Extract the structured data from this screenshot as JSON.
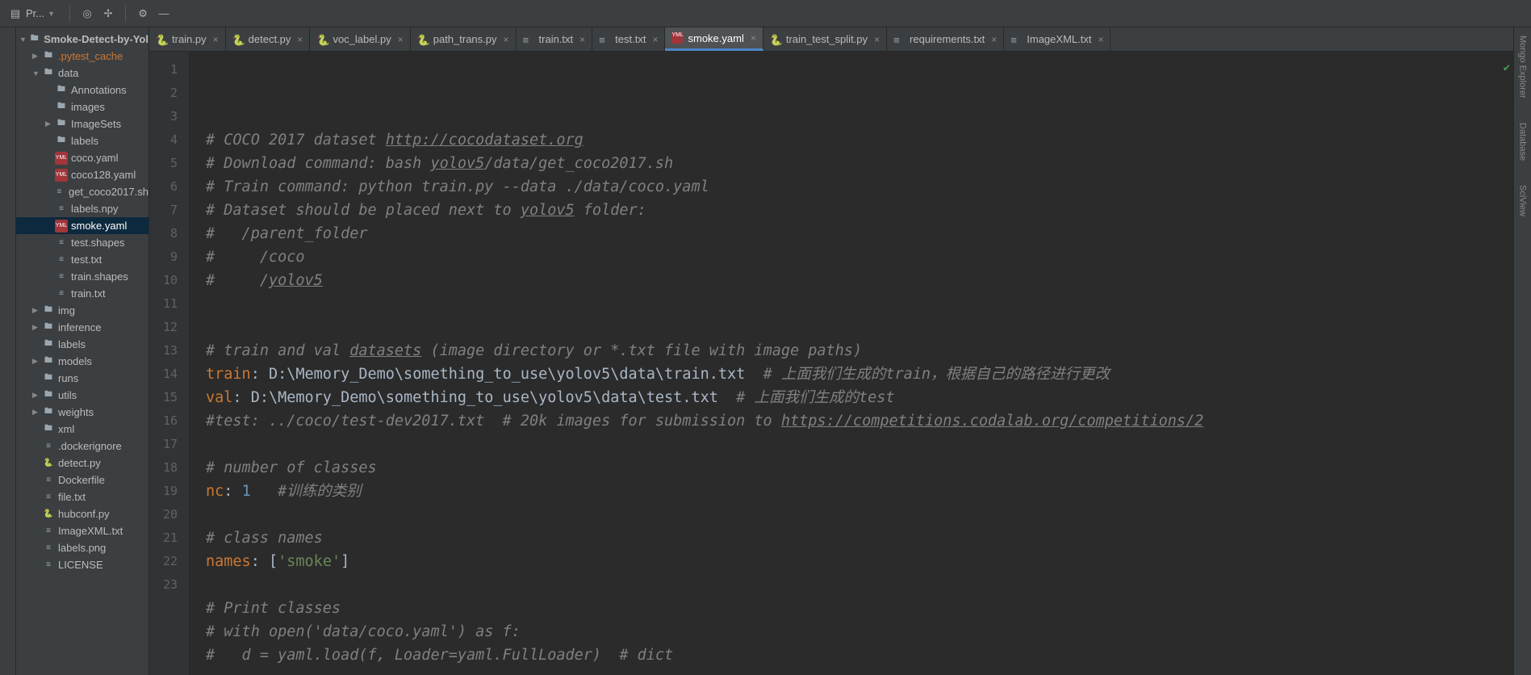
{
  "toolbar": {
    "project_label": "Pr..."
  },
  "tabs": [
    {
      "label": "train.py",
      "type": "py"
    },
    {
      "label": "detect.py",
      "type": "py"
    },
    {
      "label": "voc_label.py",
      "type": "py"
    },
    {
      "label": "path_trans.py",
      "type": "py"
    },
    {
      "label": "train.txt",
      "type": "txt"
    },
    {
      "label": "test.txt",
      "type": "txt"
    },
    {
      "label": "smoke.yaml",
      "type": "yaml",
      "active": true
    },
    {
      "label": "train_test_split.py",
      "type": "py"
    },
    {
      "label": "requirements.txt",
      "type": "txt"
    },
    {
      "label": "ImageXML.txt",
      "type": "txt"
    }
  ],
  "tree": [
    {
      "depth": 0,
      "arrow": "▼",
      "icon": "folder",
      "label": "Smoke-Detect-by-Yol",
      "bold": true
    },
    {
      "depth": 1,
      "arrow": "▶",
      "icon": "folder",
      "label": ".pytest_cache",
      "warn": true
    },
    {
      "depth": 1,
      "arrow": "▼",
      "icon": "folder",
      "label": "data"
    },
    {
      "depth": 2,
      "arrow": "",
      "icon": "folder",
      "label": "Annotations"
    },
    {
      "depth": 2,
      "arrow": "",
      "icon": "folder",
      "label": "images"
    },
    {
      "depth": 2,
      "arrow": "▶",
      "icon": "folder",
      "label": "ImageSets"
    },
    {
      "depth": 2,
      "arrow": "",
      "icon": "folder",
      "label": "labels"
    },
    {
      "depth": 2,
      "arrow": "",
      "icon": "yaml",
      "label": "coco.yaml"
    },
    {
      "depth": 2,
      "arrow": "",
      "icon": "yaml",
      "label": "coco128.yaml"
    },
    {
      "depth": 2,
      "arrow": "",
      "icon": "sh",
      "label": "get_coco2017.sh"
    },
    {
      "depth": 2,
      "arrow": "",
      "icon": "npy",
      "label": "labels.npy"
    },
    {
      "depth": 2,
      "arrow": "",
      "icon": "yaml",
      "label": "smoke.yaml",
      "selected": true
    },
    {
      "depth": 2,
      "arrow": "",
      "icon": "txt",
      "label": "test.shapes"
    },
    {
      "depth": 2,
      "arrow": "",
      "icon": "txt",
      "label": "test.txt"
    },
    {
      "depth": 2,
      "arrow": "",
      "icon": "txt",
      "label": "train.shapes"
    },
    {
      "depth": 2,
      "arrow": "",
      "icon": "txt",
      "label": "train.txt"
    },
    {
      "depth": 1,
      "arrow": "▶",
      "icon": "folder",
      "label": "img"
    },
    {
      "depth": 1,
      "arrow": "▶",
      "icon": "folder",
      "label": "inference"
    },
    {
      "depth": 1,
      "arrow": "",
      "icon": "folder",
      "label": "labels"
    },
    {
      "depth": 1,
      "arrow": "▶",
      "icon": "folder",
      "label": "models"
    },
    {
      "depth": 1,
      "arrow": "",
      "icon": "folder",
      "label": "runs"
    },
    {
      "depth": 1,
      "arrow": "▶",
      "icon": "folder",
      "label": "utils"
    },
    {
      "depth": 1,
      "arrow": "▶",
      "icon": "folder",
      "label": "weights"
    },
    {
      "depth": 1,
      "arrow": "",
      "icon": "folder",
      "label": "xml"
    },
    {
      "depth": 1,
      "arrow": "",
      "icon": "txt",
      "label": ".dockerignore"
    },
    {
      "depth": 1,
      "arrow": "",
      "icon": "py",
      "label": "detect.py"
    },
    {
      "depth": 1,
      "arrow": "",
      "icon": "txt",
      "label": "Dockerfile"
    },
    {
      "depth": 1,
      "arrow": "",
      "icon": "txt",
      "label": "file.txt"
    },
    {
      "depth": 1,
      "arrow": "",
      "icon": "py",
      "label": "hubconf.py"
    },
    {
      "depth": 1,
      "arrow": "",
      "icon": "txt",
      "label": "ImageXML.txt"
    },
    {
      "depth": 1,
      "arrow": "",
      "icon": "png",
      "label": "labels.png"
    },
    {
      "depth": 1,
      "arrow": "",
      "icon": "txt",
      "label": "LICENSE"
    }
  ],
  "right_tabs": {
    "mongo": "Mongo Explorer",
    "database": "Database",
    "sciview": "SciView"
  },
  "code_lines": [
    [
      {
        "t": "# COCO 2017 dataset ",
        "c": "c-comment"
      },
      {
        "t": "http://cocodataset.org",
        "c": "c-comment-link"
      }
    ],
    [
      {
        "t": "# Download command: bash ",
        "c": "c-comment"
      },
      {
        "t": "yolov5",
        "c": "c-comment-link"
      },
      {
        "t": "/data/get_coco2017.sh",
        "c": "c-comment"
      }
    ],
    [
      {
        "t": "# Train command: python train.py --data ./data/coco.yaml",
        "c": "c-comment"
      }
    ],
    [
      {
        "t": "# Dataset should be placed next to ",
        "c": "c-comment"
      },
      {
        "t": "yolov5",
        "c": "c-comment-link"
      },
      {
        "t": " folder:",
        "c": "c-comment"
      }
    ],
    [
      {
        "t": "#   /parent_folder",
        "c": "c-comment"
      }
    ],
    [
      {
        "t": "#     /coco",
        "c": "c-comment"
      }
    ],
    [
      {
        "t": "#     /",
        "c": "c-comment"
      },
      {
        "t": "yolov5",
        "c": "c-comment-link"
      }
    ],
    [],
    [],
    [
      {
        "t": "# train and val ",
        "c": "c-comment"
      },
      {
        "t": "datasets",
        "c": "c-comment-link"
      },
      {
        "t": " (image directory or *.txt file with image paths)",
        "c": "c-comment"
      }
    ],
    [
      {
        "t": "train",
        "c": "c-key"
      },
      {
        "t": ": ",
        "c": "c-string"
      },
      {
        "t": "D:\\Memory_Demo\\something_to_use\\yolov5\\data\\train.txt",
        "c": "c-string"
      },
      {
        "t": "  # 上面我们生成的train，根据自己的路径进行更改",
        "c": "c-comment"
      }
    ],
    [
      {
        "t": "val",
        "c": "c-key"
      },
      {
        "t": ": ",
        "c": "c-string"
      },
      {
        "t": "D:\\Memory_Demo\\something_to_use\\yolov5\\data\\test.txt",
        "c": "c-string"
      },
      {
        "t": "  # 上面我们生成的test",
        "c": "c-comment"
      }
    ],
    [
      {
        "t": "#test: ../coco/test-dev2017.txt  # 20k images for submission to ",
        "c": "c-comment"
      },
      {
        "t": "https://competitions.codalab.org/competitions/2",
        "c": "c-comment-link"
      }
    ],
    [],
    [
      {
        "t": "# number of classes",
        "c": "c-comment"
      }
    ],
    [
      {
        "t": "nc",
        "c": "c-key"
      },
      {
        "t": ": ",
        "c": "c-string"
      },
      {
        "t": "1",
        "c": "c-val"
      },
      {
        "t": "   #训练的类别",
        "c": "c-comment"
      }
    ],
    [],
    [
      {
        "t": "# class names",
        "c": "c-comment"
      }
    ],
    [
      {
        "t": "names",
        "c": "c-key"
      },
      {
        "t": ": [",
        "c": "c-string"
      },
      {
        "t": "'smoke'",
        "c": "c-str"
      },
      {
        "t": "]",
        "c": "c-string"
      }
    ],
    [],
    [
      {
        "t": "# Print classes",
        "c": "c-comment"
      }
    ],
    [
      {
        "t": "# with open('data/coco.yaml') as f:",
        "c": "c-comment"
      }
    ],
    [
      {
        "t": "#   d = yaml.load(f, Loader=yaml.FullLoader)  # dict",
        "c": "c-comment"
      }
    ]
  ]
}
